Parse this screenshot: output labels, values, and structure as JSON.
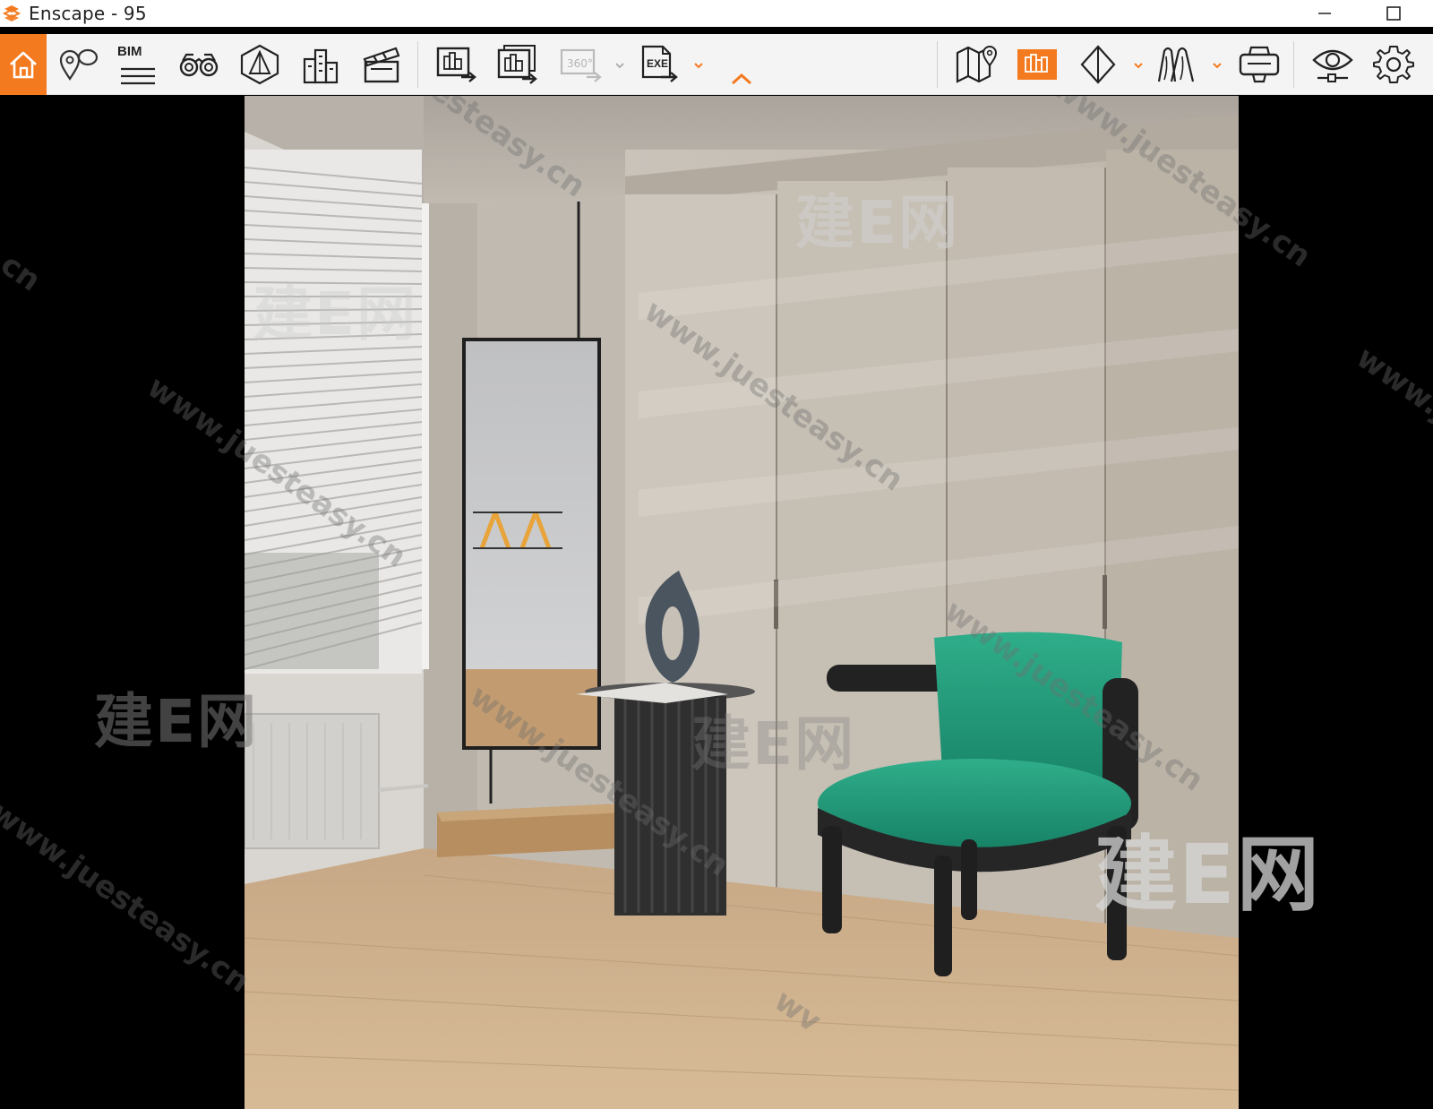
{
  "window": {
    "title": "Enscape - 95",
    "minimize_glyph": "—",
    "maximize_glyph": "☐"
  },
  "toolbar": {
    "accent_color": "#f47a1f",
    "bim_label": "BIM",
    "panorama_label": "360°",
    "exe_label": "EXE",
    "items": [
      {
        "name": "home-icon",
        "active": true
      },
      {
        "name": "views-icon"
      },
      {
        "name": "bim-icon"
      },
      {
        "name": "binoculars-icon"
      },
      {
        "name": "orthographic-icon"
      },
      {
        "name": "buildings-icon"
      },
      {
        "name": "video-editor-icon"
      },
      {
        "name": "render-screenshot-icon"
      },
      {
        "name": "batch-render-icon"
      },
      {
        "name": "panorama-icon"
      },
      {
        "name": "export-exe-icon"
      },
      {
        "name": "collapse-toolbar-icon"
      },
      {
        "name": "map-icon"
      },
      {
        "name": "asset-library-icon",
        "active": true
      },
      {
        "name": "cube-icon"
      },
      {
        "name": "light-view-icon"
      },
      {
        "name": "vr-headset-icon"
      },
      {
        "name": "visual-settings-icon"
      },
      {
        "name": "settings-icon"
      }
    ]
  },
  "watermarks": {
    "url_text": "www.juesteasy.cn",
    "url_text_short": "y.cn",
    "url_text_partial": "www.j",
    "url_text_tail": "wv",
    "brand_text": "建E网"
  }
}
